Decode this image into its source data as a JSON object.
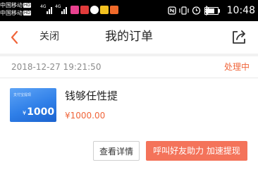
{
  "status_bar": {
    "carrier_1": "中国移动",
    "carrier_2": "中国移动",
    "hd_badge": "HD",
    "network_type": "4G",
    "time": "10:48",
    "battery_level": 0.75,
    "icons": [
      "nfc-icon",
      "vibrate-icon",
      "alarm-icon",
      "bluetooth-icon",
      "battery-icon"
    ],
    "app_icons": [
      "app-icon-pink",
      "app-icon-red",
      "app-icon-chat",
      "app-icon-yellow",
      "app-icon-orange"
    ]
  },
  "navbar": {
    "back_icon": "chevron-left-icon",
    "close_label": "关闭",
    "title": "我的订单",
    "share_icon": "share-icon",
    "accent_color": "#f0653a"
  },
  "order": {
    "date": "2018-12-27 19:21:50",
    "status": "处理中",
    "product": {
      "image_caption": "支付宝提现",
      "image_amount": "1000",
      "image_currency": "¥",
      "name": "钱够任性提",
      "price": "¥1000.00"
    },
    "buttons": {
      "detail_label": "查看详情",
      "help_label": "呼叫好友助力 加速提现"
    }
  }
}
